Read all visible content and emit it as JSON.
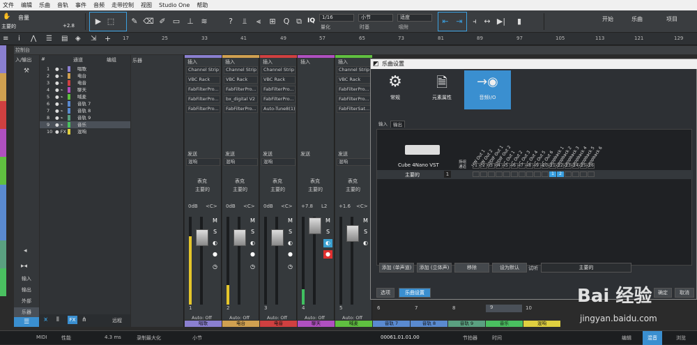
{
  "menu": [
    "文件",
    "编辑",
    "乐曲",
    "音轨",
    "事件",
    "音频",
    "走带控制",
    "视图",
    "Studio One",
    "帮助"
  ],
  "toolbar": {
    "track_name": "音量",
    "track_sub": "主要的",
    "track_value": "+2.8",
    "quantize_value": "1/16",
    "quantize_label": "量化",
    "timebase_value": "小节",
    "timebase_label": "时基",
    "snap_value": "适度",
    "snap_label": "吸附",
    "iq_label": "IQ",
    "start_label": "开始",
    "song_label": "乐曲",
    "project_label": "项目"
  },
  "ruler": {
    "marks": [
      "17",
      "25",
      "33",
      "41",
      "49",
      "57",
      "65",
      "73",
      "81",
      "89",
      "97",
      "105",
      "113",
      "121",
      "129"
    ]
  },
  "console": {
    "title": "控制台"
  },
  "io_panel": {
    "top_label": "入/输出",
    "items": [
      "输入",
      "输出",
      "外部",
      "乐器"
    ]
  },
  "tracklist": {
    "headers": {
      "num": "#",
      "channel": "通道",
      "edit": "编组"
    },
    "rows": [
      {
        "n": "1",
        "name": "唱歌",
        "color": "#8a7fd0"
      },
      {
        "n": "2",
        "name": "电台",
        "color": "#d0a050"
      },
      {
        "n": "3",
        "name": "电音",
        "color": "#d04040"
      },
      {
        "n": "4",
        "name": "聊天",
        "color": "#b050c0"
      },
      {
        "n": "5",
        "name": "喊麦",
        "color": "#60c040"
      },
      {
        "n": "6",
        "name": "音轨 7",
        "color": "#5a8ad0"
      },
      {
        "n": "7",
        "name": "音轨 8",
        "color": "#5a8ad0"
      },
      {
        "n": "8",
        "name": "音轨 9",
        "color": "#5aa080"
      },
      {
        "n": "9",
        "name": "音乐",
        "color": "#4ac060"
      },
      {
        "n": "10",
        "name": "混响",
        "color": "#e0d040"
      }
    ]
  },
  "instruments": {
    "label": "乐器",
    "remote": "远程"
  },
  "strips": [
    {
      "name": "唱歌",
      "color": "#8a7fd0",
      "inserts": [
        "Channel Strip",
        "VBC Rack",
        "FabFilterPro...",
        "FabFilterPro...",
        "FabFilterPro..."
      ],
      "send_label": "发送",
      "fx": "混响",
      "mono": "表克",
      "out": "主要的",
      "db": "0dB",
      "pan": "<C>",
      "auto": "Auto: Off"
    },
    {
      "name": "电台",
      "color": "#d0a050",
      "inserts": [
        "Channel Strip",
        "VBC Rack",
        "FabFilterPro...",
        "bx_digital V2",
        "FabFilterPro..."
      ],
      "send_label": "发送",
      "fx": "混响",
      "mono": "表克",
      "out": "主要的",
      "db": "0dB",
      "pan": "<C>",
      "auto": "Auto: Off"
    },
    {
      "name": "电音",
      "color": "#d04040",
      "inserts": [
        "Channel Strip",
        "VBC Rack",
        "FabFilterPro...",
        "FabFilterPro...",
        "Auto-Tune8(1)"
      ],
      "send_label": "发送",
      "fx": "混响",
      "mono": "表克",
      "out": "主要的",
      "db": "0dB",
      "pan": "<C>",
      "auto": "Auto: Off"
    },
    {
      "name": "聊天",
      "color": "#b050c0",
      "inserts": [
        "",
        "",
        "",
        "",
        ""
      ],
      "send_label": "发送",
      "fx": "",
      "mono": "表克",
      "out": "主要的",
      "db": "+7.8",
      "pan": "L2",
      "auto": "Auto: Off"
    },
    {
      "name": "喊麦",
      "color": "#60c040",
      "inserts": [
        "Channel Strip",
        "VBC Rack",
        "FabFilterPro...",
        "FabFilterPro...",
        "FabFilterSat..."
      ],
      "send_label": "发送",
      "fx": "混响",
      "mono": "表克",
      "out": "主要的",
      "db": "+1.6",
      "pan": "<C>",
      "auto": "Auto: Off"
    }
  ],
  "insert_label": "插入",
  "bottom_channels": [
    {
      "name": "唱歌",
      "color": "#8a7fd0"
    },
    {
      "name": "电台",
      "color": "#d0a050"
    },
    {
      "name": "电音",
      "color": "#d04040"
    },
    {
      "name": "聊天",
      "color": "#b050c0"
    },
    {
      "name": "喊麦",
      "color": "#60c040"
    },
    {
      "name": "音轨 7",
      "color": "#5a8ad0"
    },
    {
      "name": "音轨 8",
      "color": "#5a8ad0"
    },
    {
      "name": "音轨 9",
      "color": "#5aa080"
    },
    {
      "name": "音乐",
      "color": "#4ac060"
    },
    {
      "name": "混响",
      "color": "#e0d040"
    }
  ],
  "channel_numbers": [
    "1",
    "2",
    "3",
    "4",
    "5",
    "6",
    "7",
    "8",
    "9",
    "10"
  ],
  "dialog": {
    "title": "乐曲设置",
    "tabs": [
      "常规",
      "元素属性",
      "音频I/O"
    ],
    "subtabs": [
      "输入",
      "输出"
    ],
    "device": "Cube 4Nano VST",
    "speaker_col": "扬组\n通道",
    "columns": [
      "HW Out 1",
      "HW Out 2",
      "SPDIF Out 1",
      "SPDIF Out 2",
      "VC Out 1",
      "VC Out 2",
      "VC Out 3",
      "VC Out 4",
      "VC Out 5",
      "VC Out 6",
      "Loopback 1",
      "Loopback 2",
      "Loopback 3",
      "Loopback 4",
      "Loopback 5",
      "Loopback 6"
    ],
    "col_numbers": [
      "1",
      "2",
      "3",
      "4",
      "5",
      "6",
      "7",
      "8",
      "9",
      "10",
      "11",
      "12",
      "13",
      "14",
      "15",
      "16"
    ],
    "row_label": "主要的",
    "row_count": "1",
    "active_cols": [
      11,
      12
    ],
    "buttons": [
      "添加 (单声道)",
      "添加 (立体声)",
      "移除",
      "设为默认"
    ],
    "audition_label": "试听",
    "audition_value": "主要的",
    "footer_options": "选项",
    "footer_song": "乐曲设置",
    "ok": "确定",
    "cancel": "取消"
  },
  "status": {
    "midi": "MIDI",
    "perf": "性能",
    "latency": "4.3 ms",
    "rec_max": "录制最大化",
    "bar": "小节",
    "position": "00061.01.01.00",
    "beat": "节拍器",
    "time": "时间",
    "edit": "编辑",
    "mix": "混音",
    "browse": "浏览"
  },
  "watermark": {
    "brand": "Bai 经验",
    "url": "jingyan.baidu.com"
  }
}
